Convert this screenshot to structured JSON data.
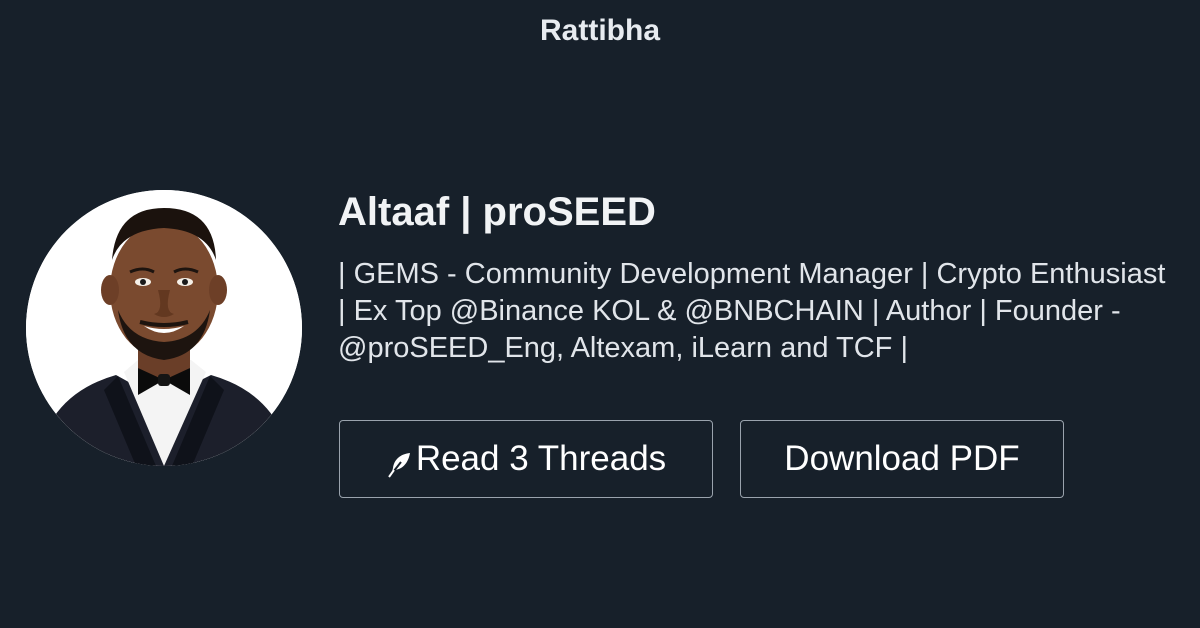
{
  "header": {
    "brand": "Rattibha"
  },
  "profile": {
    "name": "Altaaf | proSEED",
    "bio": "| GEMS - Community Development Manager | Crypto Enthusiast | Ex Top @Binance KOL & @BNBCHAIN | Author | Founder - @proSEED_Eng, Altexam, iLearn and TCF |",
    "avatar_icon": "profile-photo"
  },
  "actions": {
    "read_threads_label": "Read 3 Threads",
    "read_threads_icon": "feather-icon",
    "download_pdf_label": "Download PDF"
  },
  "colors": {
    "background": "#17202a",
    "text": "#e7ebf0",
    "button_border": "#9aa3ad"
  }
}
